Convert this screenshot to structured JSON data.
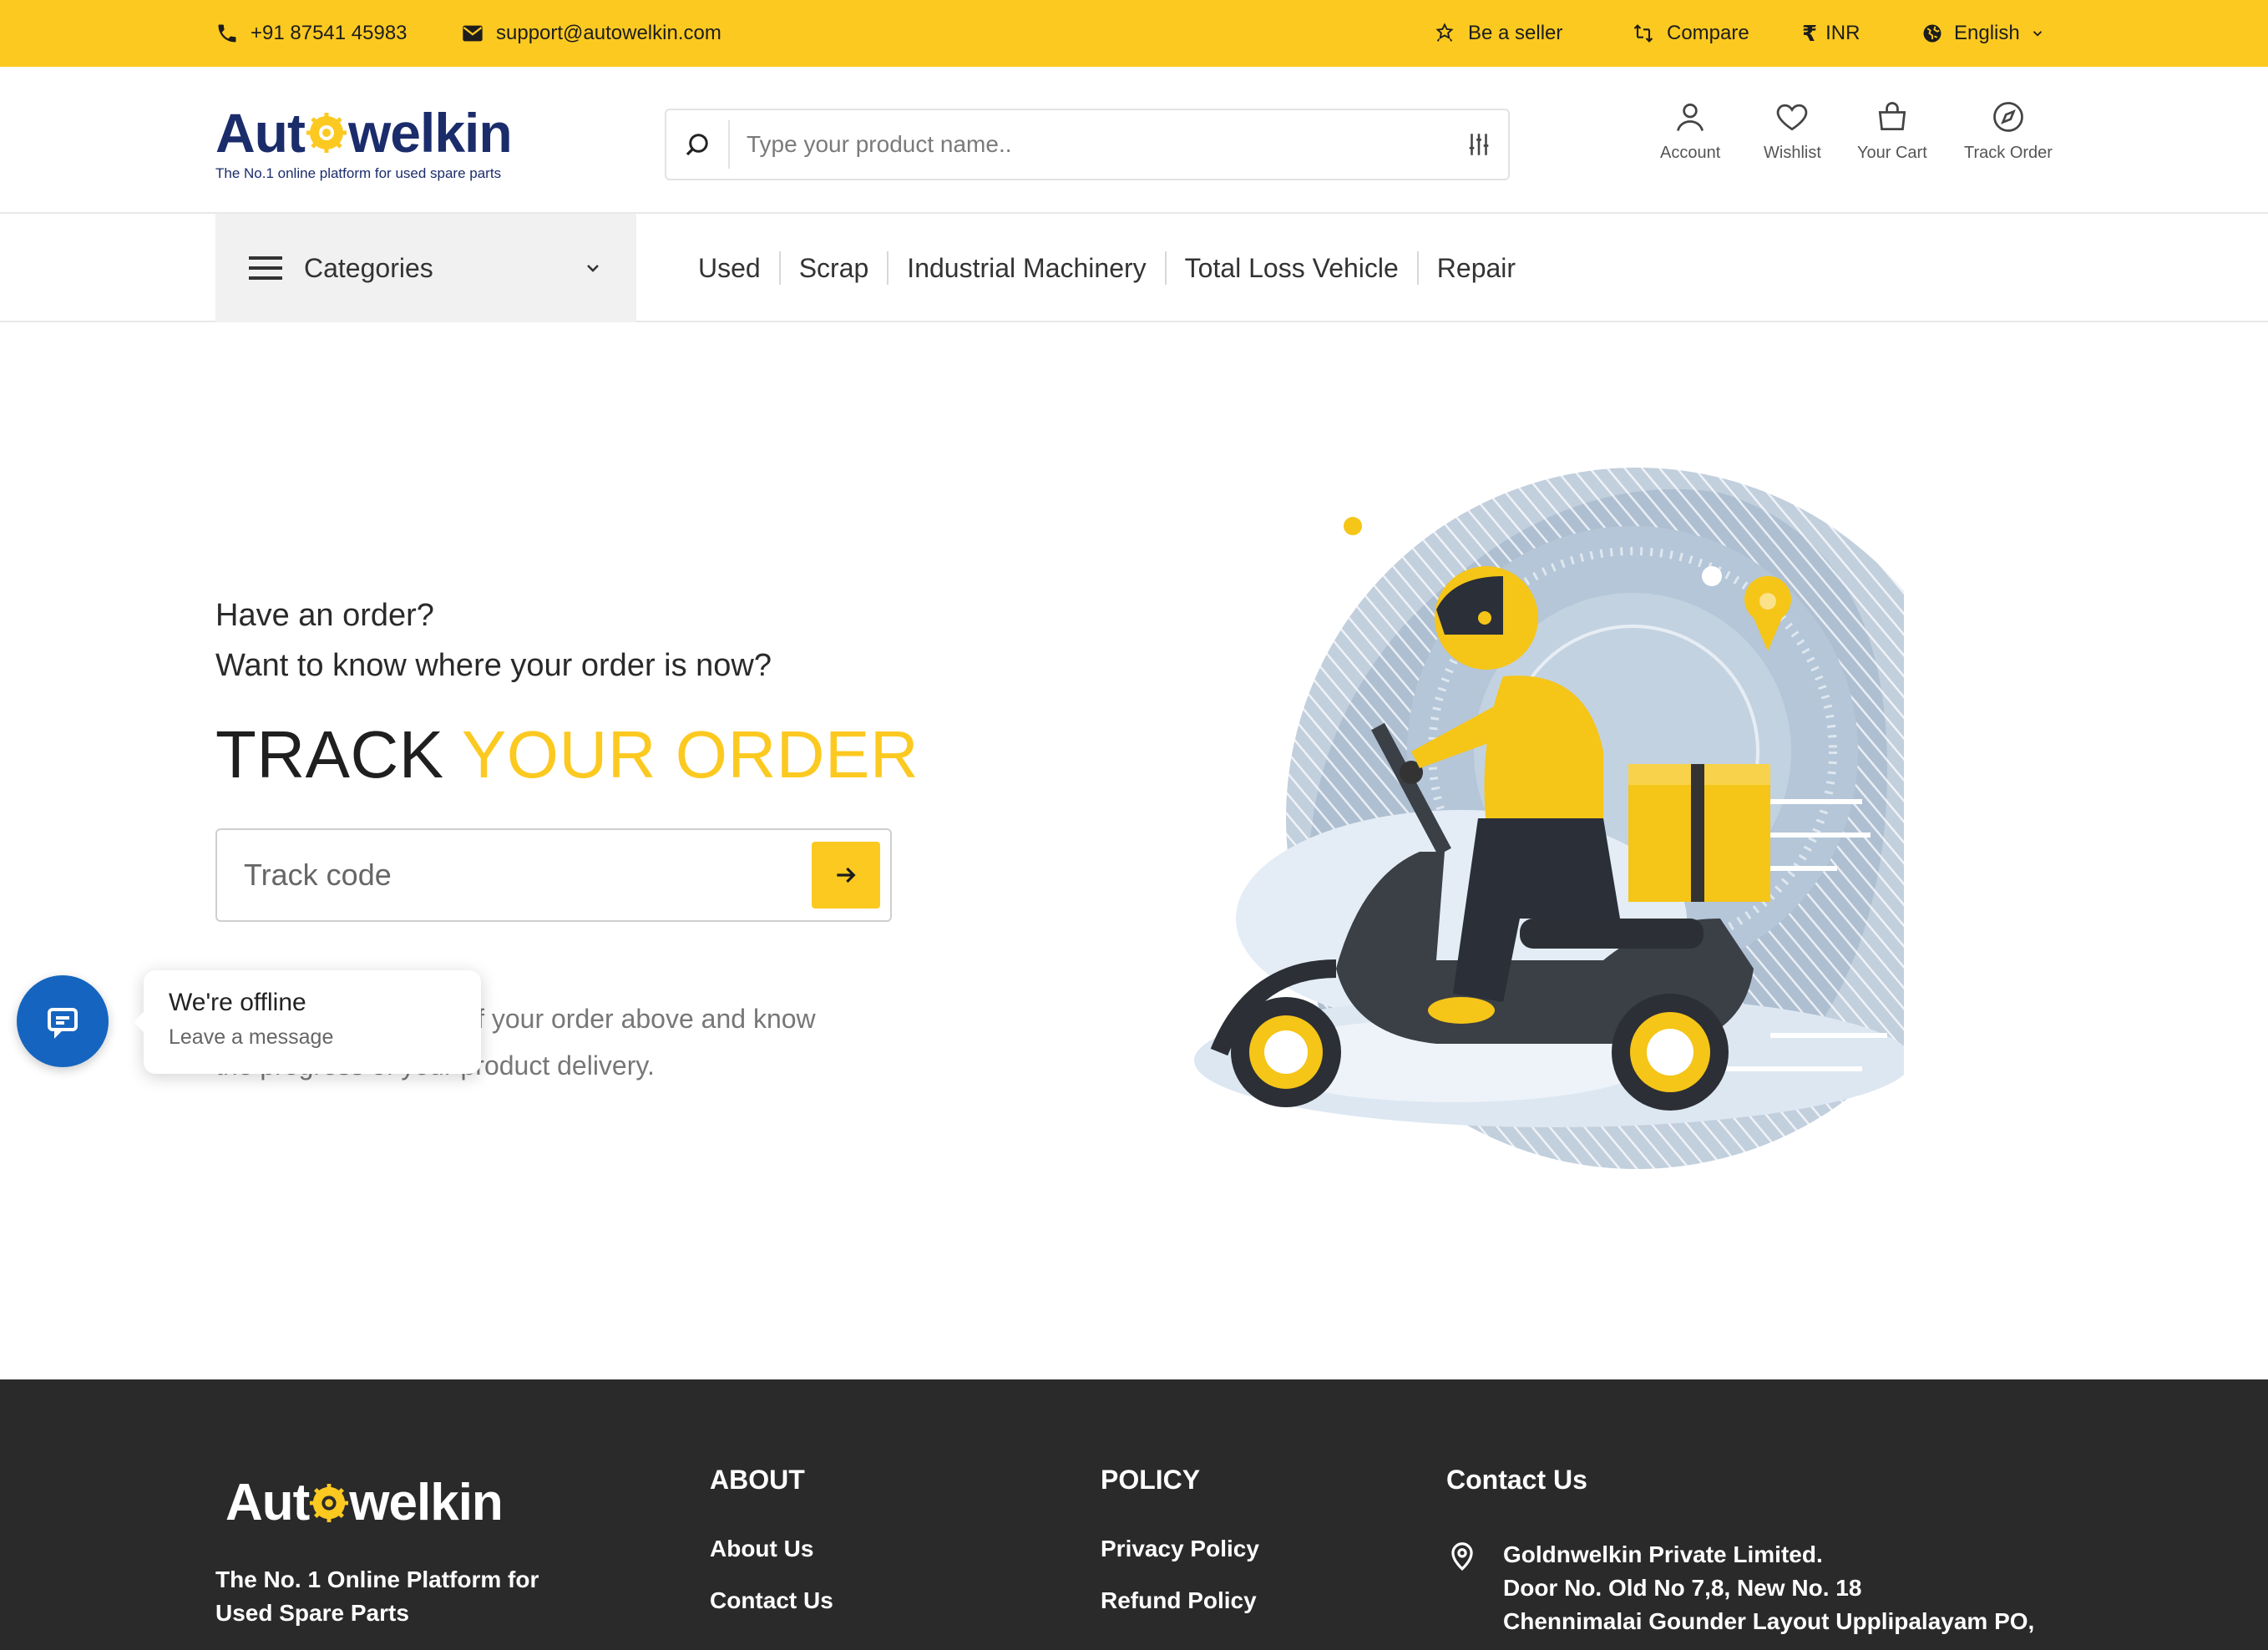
{
  "topbar": {
    "phone": "+91 87541 45983",
    "email": "support@autowelkin.com",
    "seller": "Be a seller",
    "compare": "Compare",
    "currency_symbol": "₹",
    "currency": "INR",
    "language": "English"
  },
  "header": {
    "logo_text_1": "Aut",
    "logo_text_2": "welkin",
    "logo_tagline": "The No.1 online platform for used spare parts",
    "search_placeholder": "Type your product name..",
    "account": "Account",
    "wishlist": "Wishlist",
    "cart": "Your Cart",
    "track_order": "Track Order"
  },
  "nav": {
    "categories": "Categories",
    "links": [
      "Used",
      "Scrap",
      "Industrial Machinery",
      "Total Loss Vehicle",
      "Repair"
    ]
  },
  "main": {
    "q1": "Have an order?",
    "q2": "Want to know where your order is now?",
    "title_1": "TRACK ",
    "title_2": "YOUR ORDER",
    "track_placeholder": "Track code",
    "description": "Enter the track code of your order above and know the progress of your product delivery."
  },
  "chat": {
    "title": "We're offline",
    "subtitle": "Leave a message"
  },
  "footer": {
    "logo_text_1": "Aut",
    "logo_text_2": "welkin",
    "tagline": "The No. 1 Online Platform for Used Spare Parts",
    "about_head": "ABOUT",
    "about_links": [
      "About Us",
      "Contact Us"
    ],
    "policy_head": "POLICY",
    "policy_links": [
      "Privacy Policy",
      "Refund Policy"
    ],
    "contact_head": "Contact Us",
    "address_lines": [
      "Goldnwelkin Private Limited.",
      "Door No. Old No 7,8, New No. 18",
      "Chennimalai Gounder Layout Upplipalayam PO,"
    ]
  },
  "colors": {
    "brand_yellow": "#fcc921",
    "brand_navy": "#1b2c6b",
    "chat_blue": "#1565c0",
    "footer_bg": "#2a2a2a"
  }
}
